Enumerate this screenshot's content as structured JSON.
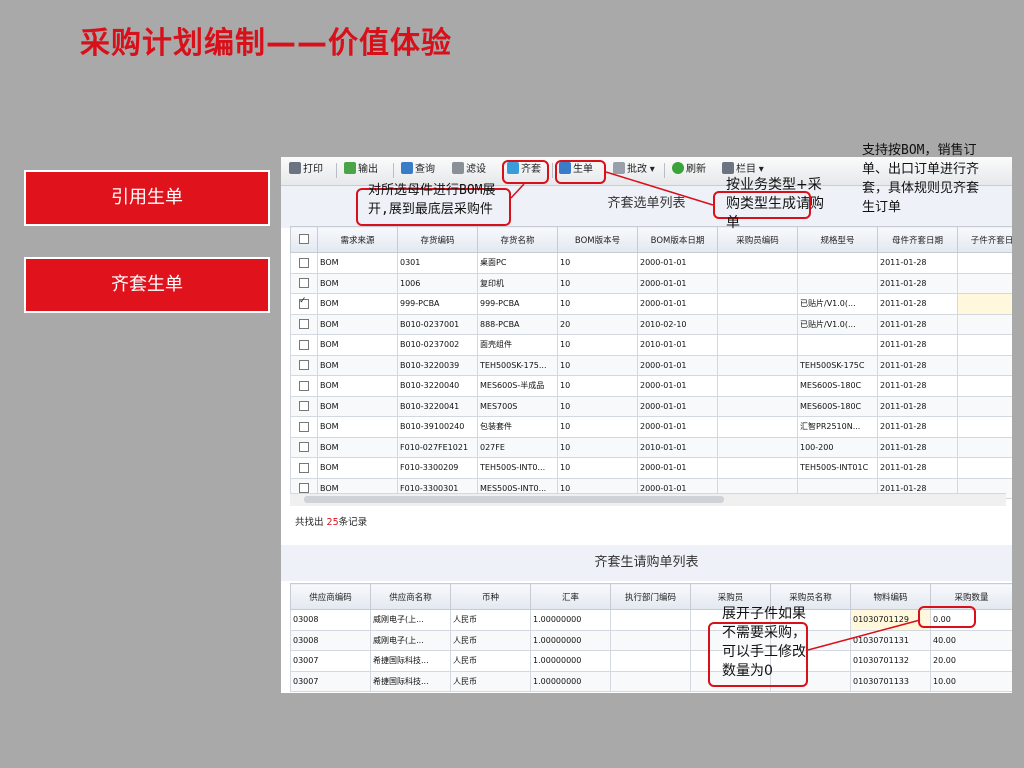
{
  "slide": {
    "title": "采购计划编制——价值体验",
    "nav": [
      "引用生单",
      "齐套生单"
    ]
  },
  "toolbar": {
    "print": "打印",
    "export": "输出",
    "query": "查询",
    "filter": "滤设",
    "kit": "齐套",
    "generate": "生单",
    "batch": "批改",
    "refresh": "刷新",
    "columns": "栏目"
  },
  "kit_list": {
    "title": "齐套选单列表",
    "columns": [
      "需求来源",
      "存货编码",
      "存货名称",
      "BOM版本号",
      "BOM版本日期",
      "采购员编码",
      "规格型号",
      "母件齐套日期",
      "子件齐套日"
    ],
    "rows": [
      {
        "checked": false,
        "src": "BOM",
        "code": "0301",
        "name": "桌面PC",
        "ver": "10",
        "date": "2000-01-01",
        "buyer": "",
        "spec": "",
        "kitdate": "2011-01-28"
      },
      {
        "checked": false,
        "src": "BOM",
        "code": "1006",
        "name": "复印机",
        "ver": "10",
        "date": "2000-01-01",
        "buyer": "",
        "spec": "",
        "kitdate": "2011-01-28"
      },
      {
        "checked": true,
        "src": "BOM",
        "code": "999-PCBA",
        "name": "999-PCBA",
        "ver": "10",
        "date": "2000-01-01",
        "buyer": "",
        "spec": "已贴片/V1.0(...",
        "kitdate": "2011-01-28"
      },
      {
        "checked": false,
        "src": "BOM",
        "code": "B010-0237001",
        "name": "888-PCBA",
        "ver": "20",
        "date": "2010-02-10",
        "buyer": "",
        "spec": "已贴片/V1.0(...",
        "kitdate": "2011-01-28"
      },
      {
        "checked": false,
        "src": "BOM",
        "code": "B010-0237002",
        "name": "面壳组件",
        "ver": "10",
        "date": "2010-01-01",
        "buyer": "",
        "spec": "",
        "kitdate": "2011-01-28"
      },
      {
        "checked": false,
        "src": "BOM",
        "code": "B010-3220039",
        "name": "TEH500SK-175...",
        "ver": "10",
        "date": "2000-01-01",
        "buyer": "",
        "spec": "TEH500SK-175C",
        "kitdate": "2011-01-28"
      },
      {
        "checked": false,
        "src": "BOM",
        "code": "B010-3220040",
        "name": "MES600S-半成品",
        "ver": "10",
        "date": "2000-01-01",
        "buyer": "",
        "spec": "MES600S-180C",
        "kitdate": "2011-01-28"
      },
      {
        "checked": false,
        "src": "BOM",
        "code": "B010-3220041",
        "name": "MES700S",
        "ver": "10",
        "date": "2000-01-01",
        "buyer": "",
        "spec": "MES600S-180C",
        "kitdate": "2011-01-28"
      },
      {
        "checked": false,
        "src": "BOM",
        "code": "B010-39100240",
        "name": "包装套件",
        "ver": "10",
        "date": "2000-01-01",
        "buyer": "",
        "spec": "汇智PR2510N...",
        "kitdate": "2011-01-28"
      },
      {
        "checked": false,
        "src": "BOM",
        "code": "F010-027FE1021",
        "name": "027FE",
        "ver": "10",
        "date": "2010-01-01",
        "buyer": "",
        "spec": "100-200",
        "kitdate": "2011-01-28"
      },
      {
        "checked": false,
        "src": "BOM",
        "code": "F010-3300209",
        "name": "TEH500S-INT0...",
        "ver": "10",
        "date": "2000-01-01",
        "buyer": "",
        "spec": "TEH500S-INT01C",
        "kitdate": "2011-01-28"
      },
      {
        "checked": false,
        "src": "BOM",
        "code": "F010-3300301",
        "name": "MES500S-INT0...",
        "ver": "10",
        "date": "2000-01-01",
        "buyer": "",
        "spec": "",
        "kitdate": "2011-01-28"
      }
    ],
    "status_prefix": "共找出",
    "status_count": "25",
    "status_suffix": "条记录"
  },
  "po_list": {
    "title": "齐套生请购单列表",
    "columns": [
      "供应商编码",
      "供应商名称",
      "币种",
      "汇率",
      "执行部门编码",
      "采购员",
      "采购员名称",
      "物料编码",
      "采购数量"
    ],
    "rows": [
      {
        "vcode": "03008",
        "vname": "威刚电子(上...",
        "cur": "人民币",
        "rate": "1.00000000",
        "dept": "",
        "buyer": "",
        "bname": "",
        "mat": "01030701129",
        "qty": "0.00"
      },
      {
        "vcode": "03008",
        "vname": "威刚电子(上...",
        "cur": "人民币",
        "rate": "1.00000000",
        "dept": "",
        "buyer": "",
        "bname": "",
        "mat": "01030701131",
        "qty": "40.00"
      },
      {
        "vcode": "03007",
        "vname": "希捷国际科技...",
        "cur": "人民币",
        "rate": "1.00000000",
        "dept": "",
        "buyer": "",
        "bname": "",
        "mat": "01030701132",
        "qty": "20.00"
      },
      {
        "vcode": "03007",
        "vname": "希捷国际科技...",
        "cur": "人民币",
        "rate": "1.00000000",
        "dept": "",
        "buyer": "",
        "bname": "",
        "mat": "01030701133",
        "qty": "10.00"
      }
    ]
  },
  "notes": {
    "kit": "对所选母件进行BOM展开,展到最底层采购件",
    "generate": "按业务类型+采购类型生成请购单",
    "rules": "支持按BOM，销售订单、出口订单进行齐套，具体规则见齐套生订单",
    "qty": "展开子件如果不需要采购，可以手工修改数量为0"
  },
  "colors": {
    "accent_red": "#d8101a",
    "slide_bg": "#a9a9a9",
    "nav_red": "#e0131d",
    "highlight_yellow": "#fff8dc"
  }
}
